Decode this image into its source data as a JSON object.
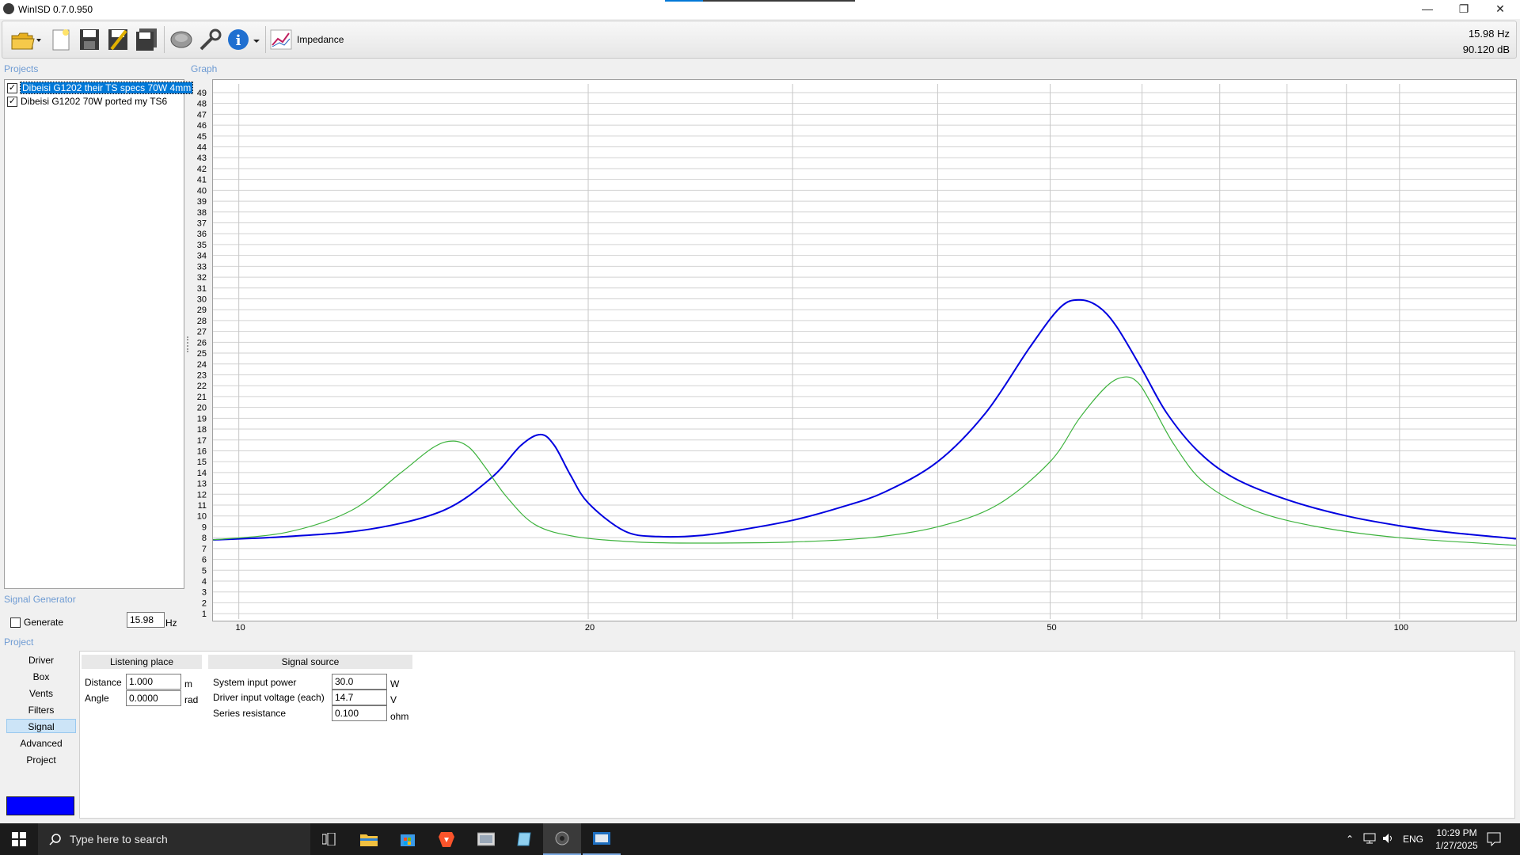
{
  "window": {
    "title": "WinISD 0.7.0.950"
  },
  "toolbar": {
    "plot_label": "Impedance",
    "readout_freq": "15.98 Hz",
    "readout_db": "90.120 dB"
  },
  "projects": {
    "label": "Projects",
    "items": [
      {
        "name": "Dibeisi G1202 their TS specs 70W 4mm",
        "checked": true,
        "selected": true
      },
      {
        "name": "Dibeisi G1202 70W ported my TS6",
        "checked": true,
        "selected": false
      }
    ]
  },
  "graph": {
    "label": "Graph"
  },
  "signal_generator": {
    "label": "Signal Generator",
    "generate_label": "Generate",
    "frequency": "15.98",
    "unit": "Hz"
  },
  "project_panel": {
    "label": "Project",
    "nav": [
      "Driver",
      "Box",
      "Vents",
      "Filters",
      "Signal",
      "Advanced",
      "Project"
    ],
    "selected_nav": "Signal",
    "listening": {
      "header": "Listening place",
      "distance_label": "Distance",
      "distance_value": "1.000",
      "distance_unit": "m",
      "angle_label": "Angle",
      "angle_value": "0.0000",
      "angle_unit": "rad"
    },
    "source": {
      "header": "Signal source",
      "power_label": "System input power",
      "power_value": "30.0",
      "power_unit": "W",
      "voltage_label": "Driver input voltage (each)",
      "voltage_value": "14.7",
      "voltage_unit": "V",
      "resistance_label": "Series resistance",
      "resistance_value": "0.100",
      "resistance_unit": "ohm"
    },
    "color_button": "Color",
    "color_value": "#0000ff"
  },
  "taskbar": {
    "search_placeholder": "Type here to search",
    "lang": "ENG",
    "time": "10:29 PM",
    "date": "1/27/2025"
  },
  "chart_data": {
    "type": "line",
    "xscale": "log",
    "xlim": [
      9.5,
      126
    ],
    "ylim": [
      0.5,
      49.8
    ],
    "x_ticks": [
      10,
      20,
      50,
      100
    ],
    "y_ticks": [
      1,
      2,
      3,
      4,
      5,
      6,
      7,
      8,
      9,
      10,
      11,
      12,
      13,
      14,
      15,
      16,
      17,
      18,
      19,
      20,
      21,
      22,
      23,
      24,
      25,
      26,
      27,
      28,
      29,
      30,
      31,
      32,
      33,
      34,
      35,
      36,
      37,
      38,
      39,
      40,
      41,
      42,
      43,
      44,
      45,
      46,
      47,
      48,
      49
    ],
    "grid": true,
    "series": [
      {
        "color": "#0000e0",
        "x": [
          9.5,
          11,
          13,
          15,
          16.5,
          17.5,
          18.2,
          18.7,
          19.3,
          20,
          21.5,
          23,
          25,
          27,
          30,
          33,
          36,
          40,
          44,
          48,
          51,
          53,
          55,
          57,
          60,
          63,
          67,
          72,
          80,
          90,
          100,
          110,
          126
        ],
        "y": [
          7.8,
          8.1,
          8.8,
          10.5,
          13.5,
          16.5,
          17.5,
          16.5,
          13.8,
          11.2,
          8.6,
          8.1,
          8.2,
          8.7,
          9.6,
          10.8,
          12.2,
          15,
          19.5,
          25.5,
          29.2,
          29.9,
          29.3,
          27.5,
          23.5,
          19.5,
          16,
          13.5,
          11.5,
          10,
          9.1,
          8.5,
          7.9
        ]
      },
      {
        "color": "#3db33d",
        "x": [
          9.5,
          11,
          12.5,
          13.8,
          14.7,
          15.3,
          15.8,
          16.3,
          17,
          18,
          19.5,
          22,
          25,
          30,
          35,
          40,
          45,
          50,
          53,
          56,
          58,
          59.5,
          61,
          64,
          68,
          75,
          85,
          100,
          126
        ],
        "y": [
          7.8,
          8.5,
          10.5,
          14,
          16.3,
          16.9,
          16.3,
          14.5,
          11.8,
          9.2,
          8.1,
          7.6,
          7.5,
          7.6,
          8,
          9,
          11,
          15,
          19,
          22,
          22.8,
          22.3,
          20.5,
          16.5,
          13,
          10.5,
          9,
          8,
          7.3
        ]
      }
    ]
  }
}
